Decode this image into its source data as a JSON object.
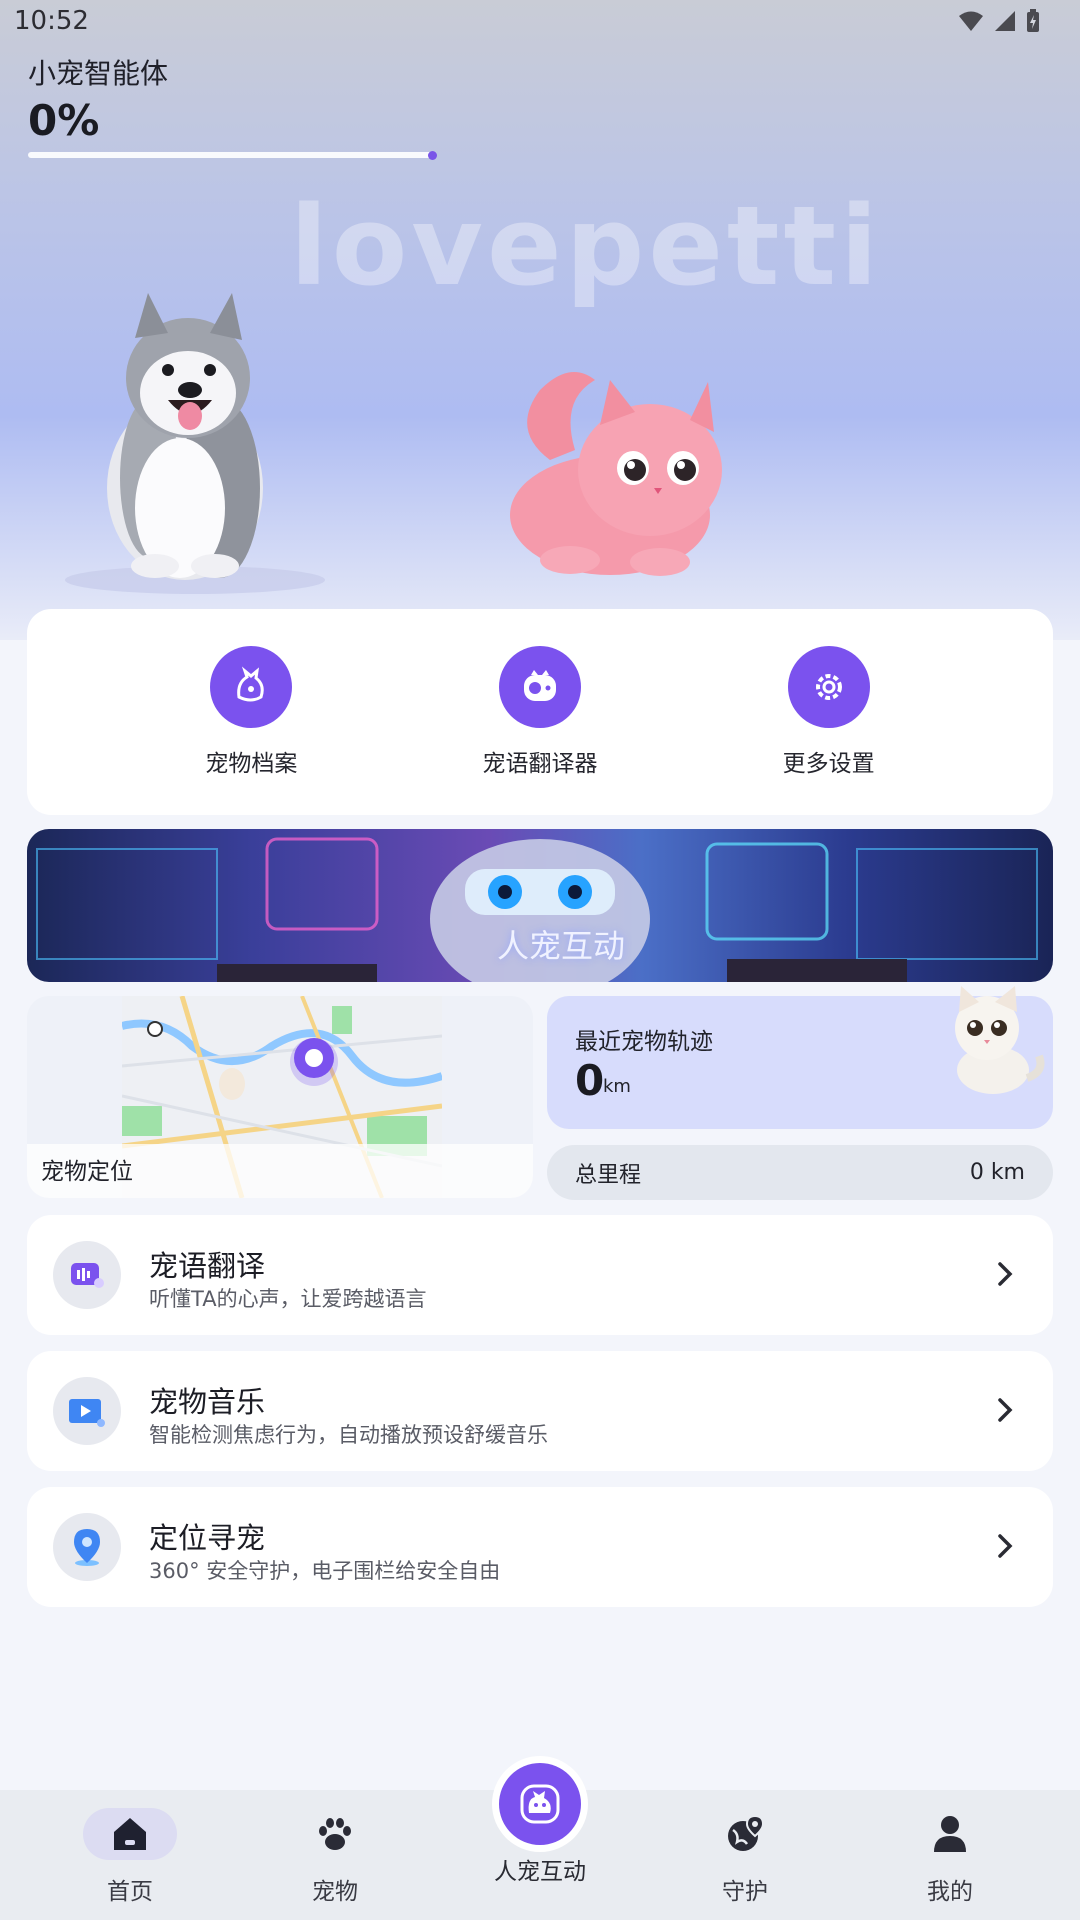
{
  "status_bar": {
    "time": "10:52"
  },
  "agent": {
    "title": "小宠智能体",
    "progress": "0%",
    "progress_value": 0
  },
  "brand": {
    "logo_text": "lovepetti"
  },
  "shortcuts": [
    {
      "label": "宠物档案",
      "icon": "pet-profile-icon"
    },
    {
      "label": "宠语翻译器",
      "icon": "translator-device-icon"
    },
    {
      "label": "更多设置",
      "icon": "gear-icon"
    }
  ],
  "banner": {
    "text": "人宠互动"
  },
  "location_card": {
    "label": "宠物定位"
  },
  "track_card": {
    "title": "最近宠物轨迹",
    "value": "0",
    "unit": "km"
  },
  "mileage": {
    "label": "总里程",
    "value": "0 km"
  },
  "features": [
    {
      "title": "宠语翻译",
      "subtitle": "听懂TA的心声，让爱跨越语言",
      "icon": "translate-chat-icon"
    },
    {
      "title": "宠物音乐",
      "subtitle": "智能检测焦虑行为，自动播放预设舒缓音乐",
      "icon": "music-video-icon"
    },
    {
      "title": "定位寻宠",
      "subtitle": "360° 安全守护，电子围栏给安全自由",
      "icon": "location-pin-icon"
    }
  ],
  "tabbar": {
    "home": "首页",
    "pets": "宠物",
    "interact": "人宠互动",
    "guard": "守护",
    "mine": "我的"
  },
  "colors": {
    "accent": "#7b52ee",
    "card_bg": "#ffffff",
    "track_bg": "#d7dcfc"
  }
}
